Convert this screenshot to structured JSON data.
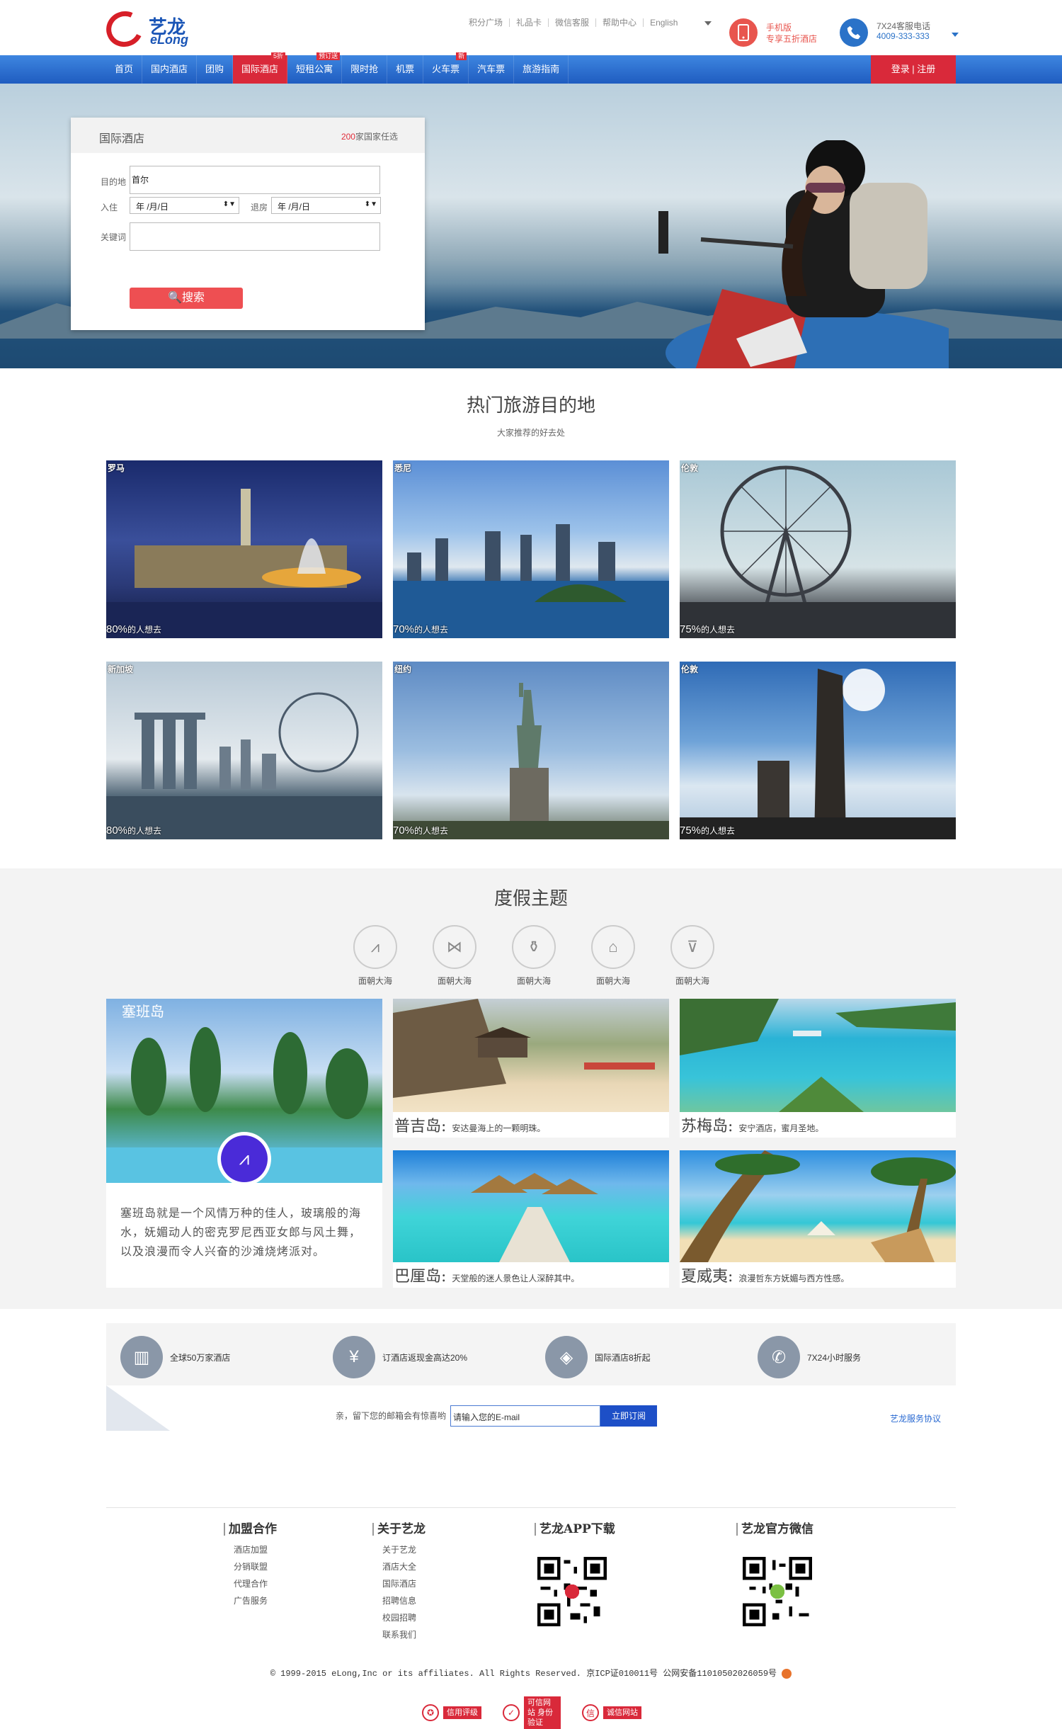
{
  "header": {
    "logo_cn": "艺龙",
    "logo_en": "eLong",
    "top_links": [
      "积分广场",
      "礼品卡",
      "微信客服",
      "帮助中心",
      "English"
    ],
    "mobile_line1": "手机版",
    "mobile_line2": "专享五折酒店",
    "tel_line1": "7X24客服电话",
    "tel_line2": "4009-333-333"
  },
  "nav": {
    "items": [
      {
        "label": "首页",
        "badge": ""
      },
      {
        "label": "国内酒店",
        "badge": ""
      },
      {
        "label": "团购",
        "badge": ""
      },
      {
        "label": "国际酒店",
        "badge": "5折"
      },
      {
        "label": "短租公寓",
        "badge": "预订送"
      },
      {
        "label": "限时抢",
        "badge": ""
      },
      {
        "label": "机票",
        "badge": ""
      },
      {
        "label": "火车票",
        "badge": "新"
      },
      {
        "label": "汽车票",
        "badge": ""
      },
      {
        "label": "旅游指南",
        "badge": ""
      }
    ],
    "login": "登录 | 注册"
  },
  "search": {
    "title": "国际酒店",
    "count_num": "200",
    "count_text": "家国家任选",
    "dest_label": "目的地",
    "dest_value": "首尔",
    "checkin_label": "入住",
    "checkin_value": "年 /月/日",
    "checkout_label": "退房",
    "checkout_value": "年 /月/日",
    "keyword_label": "关键词",
    "keyword_value": "",
    "button": "搜索"
  },
  "destinations": {
    "title": "热门旅游目的地",
    "subtitle": "大家推荐的好去处",
    "suffix": "的人想去",
    "items": [
      {
        "name": "罗马",
        "pct": "80%"
      },
      {
        "name": "悉尼",
        "pct": "70%"
      },
      {
        "name": "伦敦",
        "pct": "75%"
      },
      {
        "name": "新加坡",
        "pct": "80%"
      },
      {
        "name": "纽约",
        "pct": "70%"
      },
      {
        "name": "伦敦",
        "pct": "75%"
      }
    ]
  },
  "theme": {
    "title": "度假主题",
    "icons": [
      {
        "label": "面朝大海",
        "icon": "wave-icon"
      },
      {
        "label": "面朝大海",
        "icon": "bowtie-icon"
      },
      {
        "label": "面朝大海",
        "icon": "bottle-icon"
      },
      {
        "label": "面朝大海",
        "icon": "house-icon"
      },
      {
        "label": "面朝大海",
        "icon": "bag-icon"
      }
    ],
    "feature_name": "塞班岛",
    "feature_text": "塞班岛就是一个风情万种的佳人，玻璃般的海水，妩媚动人的密克罗尼西亚女郎与风土舞，以及浪漫而令人兴奋的沙滩烧烤派对。",
    "cards": [
      {
        "name": "普吉岛:",
        "desc": "安达曼海上的一颗明珠。"
      },
      {
        "name": "苏梅岛:",
        "desc": "安宁酒店，蜜月圣地。"
      },
      {
        "name": "巴厘岛:",
        "desc": "天堂般的迷人景色让人深醉其中。"
      },
      {
        "name": "夏威夷:",
        "desc": "浪漫哲东方妩媚与西方性感。"
      }
    ]
  },
  "features": [
    {
      "label": "全球50万家酒店",
      "icon": "building-icon"
    },
    {
      "label": "订酒店返现金高达20%",
      "icon": "yen-icon"
    },
    {
      "label": "国际酒店8折起",
      "icon": "tag-icon"
    },
    {
      "label": "7X24小时服务",
      "icon": "phone-icon"
    }
  ],
  "subscribe": {
    "tip": "亲，留下您的邮箱会有惊喜哟",
    "placeholder": "请输入您的E-mail",
    "button": "立即订阅",
    "link": "艺龙服务协议"
  },
  "footer": {
    "col1_title": "加盟合作",
    "col1": [
      "酒店加盟",
      "分销联盟",
      "代理合作",
      "广告服务"
    ],
    "col2_title": "关于艺龙",
    "col2": [
      "关于艺龙",
      "酒店大全",
      "国际酒店",
      "招聘信息",
      "校园招聘",
      "联系我们"
    ],
    "col3_title": "艺龙APP下载",
    "col4_title": "艺龙官方微信",
    "copyright": "© 1999-2015 eLong,Inc or its affiliates. All Rights Reserved. 京ICP证010011号 公网安备11010502026059号",
    "certs": [
      "信用评级",
      "可信网站 身份验证",
      "诚信网站"
    ]
  },
  "colors": {
    "brand_blue": "#1f5cc0",
    "brand_red": "#d9293a",
    "button_red": "#ee4f52"
  }
}
